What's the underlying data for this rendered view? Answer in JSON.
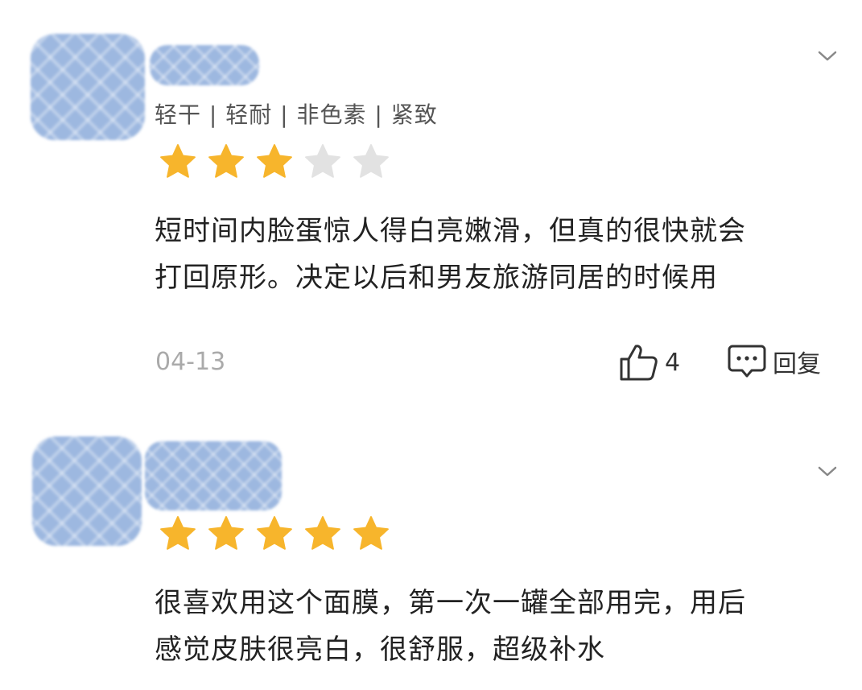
{
  "colors": {
    "star_filled": "#f7b52c",
    "star_empty": "#e2e2e2",
    "text": "#222222",
    "tags_text": "#555555",
    "date_text": "#aaaaaa"
  },
  "reviews": [
    {
      "tags": "轻干 | 轻耐 | 非色素 | 紧致",
      "rating": 3,
      "max_rating": 5,
      "text_lines": [
        "短时间内脸蛋惊人得白亮嫩滑，但真的很快就会",
        "打回原形。决定以后和男友旅游同居的时候用"
      ],
      "date": "04-13",
      "likes": "4",
      "reply_label": "回复",
      "icons": [
        "chevron-down-icon",
        "thumbs-up-icon",
        "comment-icon"
      ]
    },
    {
      "rating": 5,
      "max_rating": 5,
      "text_lines": [
        "很喜欢用这个面膜，第一次一罐全部用完，用后",
        "感觉皮肤很亮白，很舒服，超级补水"
      ],
      "icons": [
        "chevron-down-icon"
      ]
    }
  ]
}
